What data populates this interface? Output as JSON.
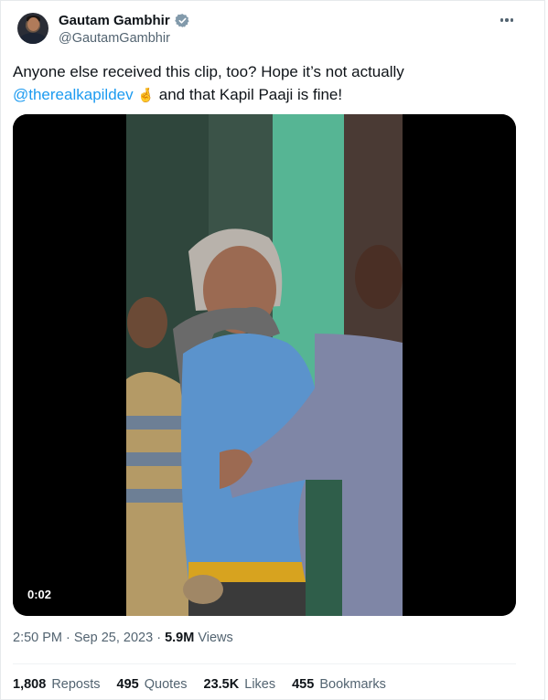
{
  "author": {
    "display_name": "Gautam Gambhir",
    "handle": "@GautamGambhir"
  },
  "tweet": {
    "text_before": "Anyone else received this clip, too? Hope it’s not actually ",
    "mention": "@therealkapildev",
    "emoji": "🤞",
    "text_after": " and that Kapil Paaji is fine!"
  },
  "video": {
    "duration": "0:02"
  },
  "meta": {
    "time": "2:50 PM",
    "date": "Sep 25, 2023",
    "separator": " · ",
    "views_count": "5.9M",
    "views_label": " Views"
  },
  "stats": {
    "reposts_count": "1,808",
    "reposts_label": "Reposts",
    "quotes_count": "495",
    "quotes_label": "Quotes",
    "likes_count": "23.5K",
    "likes_label": "Likes",
    "bookmarks_count": "455",
    "bookmarks_label": "Bookmarks"
  },
  "colors": {
    "link": "#1d9bf0",
    "secondary_text": "#536471",
    "verified_badge": "#829aab"
  },
  "icons": [
    "verified-badge-icon",
    "more-options-icon"
  ]
}
